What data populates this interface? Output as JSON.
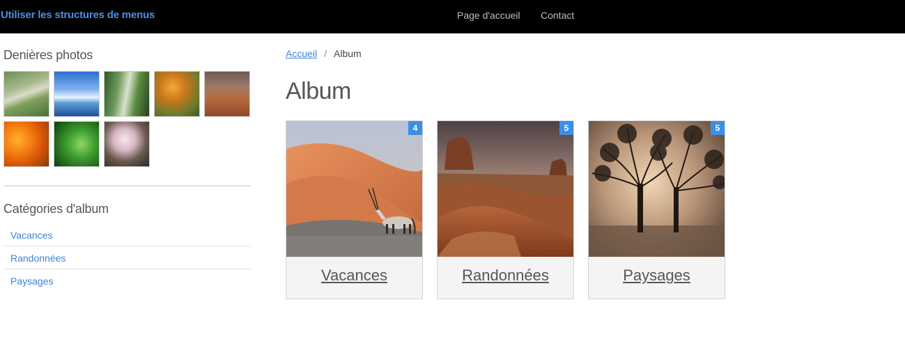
{
  "header": {
    "brand": "Utiliser les structures de menus",
    "nav": [
      {
        "label": "Page d'accueil"
      },
      {
        "label": "Contact"
      }
    ]
  },
  "sidebar": {
    "recent_heading": "Denières photos",
    "categories_heading": "Catégories d'album",
    "categories": [
      {
        "label": "Vacances"
      },
      {
        "label": "Randonnées"
      },
      {
        "label": "Paysages"
      }
    ]
  },
  "breadcrumb": {
    "home": "Accueil",
    "separator": "/",
    "current": "Album"
  },
  "main": {
    "title": "Album",
    "albums": [
      {
        "label": "Vacances",
        "count": "4"
      },
      {
        "label": "Randonnées",
        "count": "5"
      },
      {
        "label": "Paysages",
        "count": "5"
      }
    ]
  },
  "colors": {
    "accent": "#3d83d6",
    "brand": "#4a90e2",
    "badge": "#3d8fe6",
    "topbar": "#000000"
  }
}
